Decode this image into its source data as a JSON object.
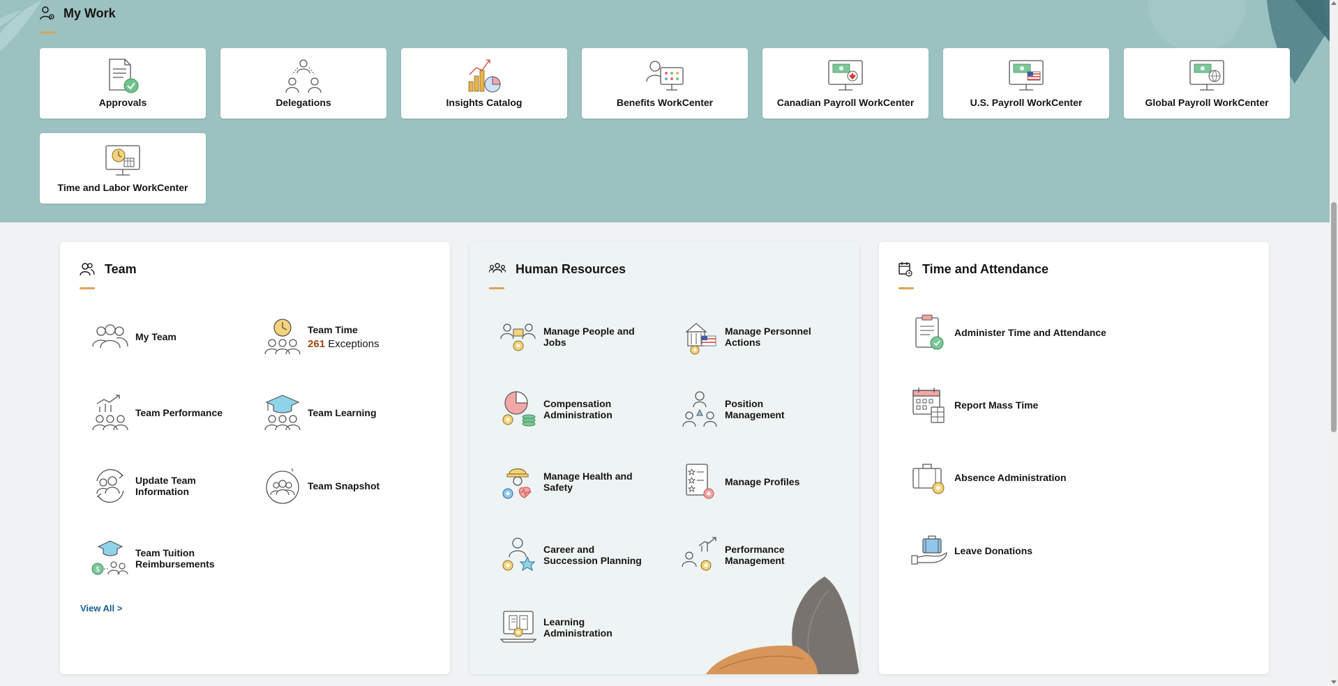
{
  "my_work": {
    "title": "My Work",
    "tiles": [
      {
        "label": "Approvals",
        "icon": "approvals-icon"
      },
      {
        "label": "Delegations",
        "icon": "delegations-icon"
      },
      {
        "label": "Insights Catalog",
        "icon": "insights-catalog-icon"
      },
      {
        "label": "Benefits WorkCenter",
        "icon": "benefits-workcenter-icon"
      },
      {
        "label": "Canadian Payroll WorkCenter",
        "icon": "canadian-payroll-icon"
      },
      {
        "label": "U.S. Payroll WorkCenter",
        "icon": "us-payroll-icon"
      },
      {
        "label": "Global Payroll WorkCenter",
        "icon": "global-payroll-icon"
      },
      {
        "label": "Time and Labor WorkCenter",
        "icon": "time-labor-workcenter-icon"
      }
    ]
  },
  "team": {
    "title": "Team",
    "items": [
      {
        "label": "My Team"
      },
      {
        "label": "Team Time",
        "count": "261",
        "sub": "Exceptions"
      },
      {
        "label": "Team Performance"
      },
      {
        "label": "Team Learning"
      },
      {
        "label": "Update Team Information"
      },
      {
        "label": "Team Snapshot"
      },
      {
        "label": "Team Tuition Reimbursements"
      }
    ],
    "view_all": "View All >"
  },
  "hr": {
    "title": "Human Resources",
    "items": [
      {
        "label": "Manage People and Jobs"
      },
      {
        "label": "Manage Personnel Actions"
      },
      {
        "label": "Compensation Administration"
      },
      {
        "label": "Position Management"
      },
      {
        "label": "Manage Health and Safety"
      },
      {
        "label": "Manage Profiles"
      },
      {
        "label": "Career and Succession Planning"
      },
      {
        "label": "Performance Management"
      },
      {
        "label": "Learning Administration"
      }
    ]
  },
  "time": {
    "title": "Time and Attendance",
    "items": [
      {
        "label": "Administer Time and Attendance"
      },
      {
        "label": "Report Mass Time"
      },
      {
        "label": "Absence Administration"
      },
      {
        "label": "Leave Donations"
      }
    ]
  },
  "colors": {
    "band": "#9bc1c0",
    "accent_underline": "#e0a05a",
    "count": "#a04a10",
    "link": "#1a5e8f"
  }
}
